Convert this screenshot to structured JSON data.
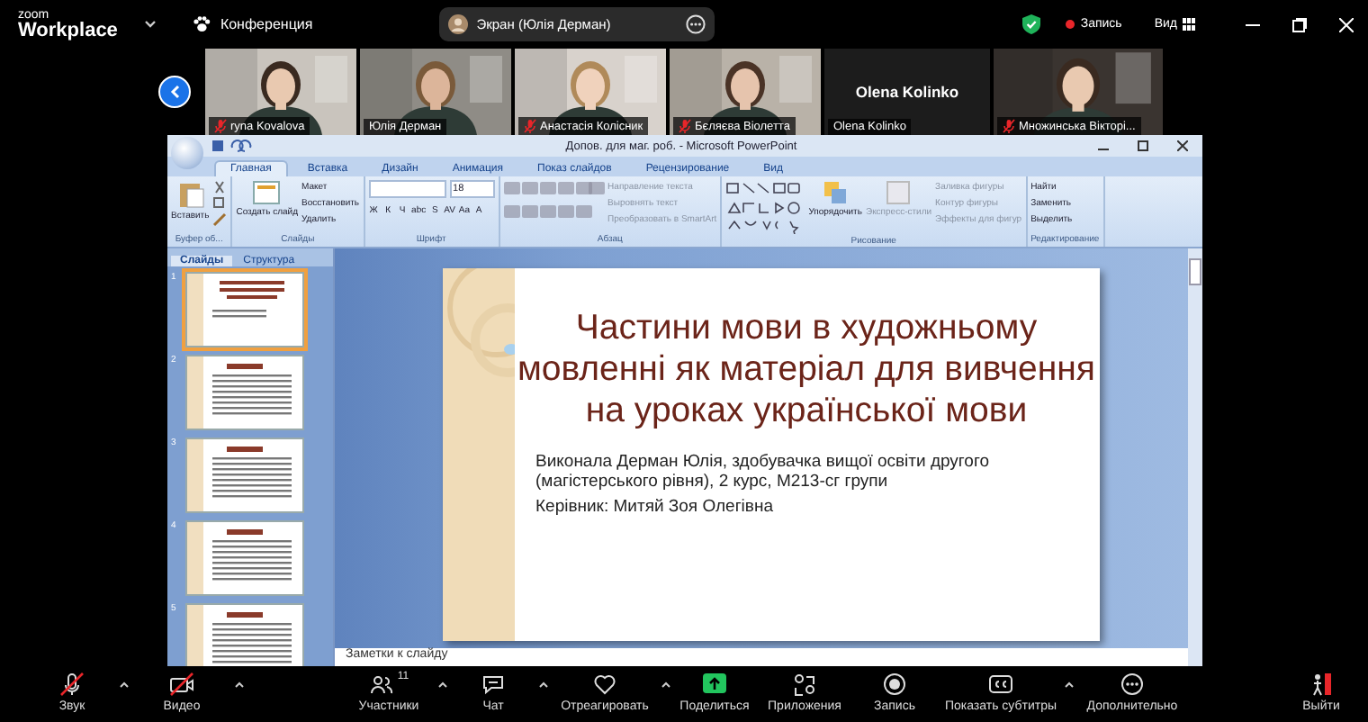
{
  "topbar": {
    "logo_small": "zoom",
    "logo": "Workplace",
    "meeting": "Конференция",
    "share_pill": "Экран (Юлія Дерман)",
    "recording": "Запись",
    "view": "Вид"
  },
  "participants": [
    {
      "kind": "video",
      "name": "ryna Kovalova",
      "muted": true
    },
    {
      "kind": "video",
      "name": "Юлія Дерман",
      "muted": false
    },
    {
      "kind": "video",
      "name": "Анастасія Колісник",
      "muted": true
    },
    {
      "kind": "video",
      "name": "Бєляєва Віолетта",
      "muted": true
    },
    {
      "kind": "name",
      "name": "Olena Kolinko",
      "muted": false,
      "display": "Olena Kolinko"
    },
    {
      "kind": "video",
      "name": "Множинська Вікторі...",
      "muted": true
    }
  ],
  "powerpoint": {
    "title": "Допов. для маг. роб. - Microsoft PowerPoint",
    "tabs": [
      {
        "label": "Главная",
        "selected": true
      },
      {
        "label": "Вставка",
        "selected": false
      },
      {
        "label": "Дизайн",
        "selected": false
      },
      {
        "label": "Анимация",
        "selected": false
      },
      {
        "label": "Показ слайдов",
        "selected": false
      },
      {
        "label": "Рецензирование",
        "selected": false
      },
      {
        "label": "Вид",
        "selected": false
      }
    ],
    "groups": [
      {
        "kind": "clipboard",
        "label": "Буфер об...",
        "big": [
          "Вставить"
        ]
      },
      {
        "kind": "slides",
        "label": "Слайды",
        "big": [
          "Создать слайд"
        ],
        "items": [
          "Макет",
          "Восстановить",
          "Удалить"
        ]
      },
      {
        "kind": "font",
        "label": "Шрифт",
        "size": "18",
        "buttons": [
          "Ж",
          "К",
          "Ч",
          "abc",
          "S",
          "AV",
          "Aa",
          "A"
        ]
      },
      {
        "kind": "paragraph",
        "label": "Абзац",
        "items": [
          "Направление текста",
          "Выровнять текст",
          "Преобразовать в SmartArt"
        ]
      },
      {
        "kind": "drawing",
        "label": "Рисование",
        "big": [
          "Упорядочить",
          "Экспресс-стили"
        ],
        "items": [
          "Заливка фигуры",
          "Контур фигуры",
          "Эффекты для фигур"
        ]
      },
      {
        "kind": "editing",
        "label": "Редактирование",
        "items": [
          "Найти",
          "Заменить",
          "Выделить"
        ]
      }
    ],
    "panel_tabs": [
      {
        "label": "Слайды",
        "selected": true
      },
      {
        "label": "Структура",
        "selected": false
      }
    ],
    "thumbnails": [
      {
        "number": "1",
        "selected": true
      },
      {
        "number": "2",
        "selected": false
      },
      {
        "number": "3",
        "selected": false
      },
      {
        "number": "4",
        "selected": false
      },
      {
        "number": "5",
        "selected": false
      }
    ],
    "slide": {
      "title": "Частини мови в художньому мовленні як матеріал для вивчення на уроках української мови",
      "body": [
        "Виконала Дерман Юлія, здобувачка вищої освіти другого (магістерського рівня), 2 курс, М213-сг групи",
        "Керівник: Митяй Зоя Олегівна"
      ]
    },
    "notes": "Заметки к слайду"
  },
  "toolbar": [
    {
      "kind": "mic",
      "label": "Звук",
      "off": true,
      "caret": true
    },
    {
      "kind": "camera",
      "label": "Видео",
      "off": true,
      "caret": true
    },
    {
      "kind": "participants",
      "label": "Участники",
      "count": "11",
      "caret": true
    },
    {
      "kind": "chat",
      "label": "Чат",
      "caret": true
    },
    {
      "kind": "react",
      "label": "Отреагировать",
      "caret": true
    },
    {
      "kind": "share",
      "label": "Поделиться",
      "caret": false
    },
    {
      "kind": "apps",
      "label": "Приложения",
      "caret": false
    },
    {
      "kind": "record",
      "label": "Запись",
      "caret": false
    },
    {
      "kind": "captions",
      "label": "Показать субтитры",
      "caret": true
    },
    {
      "kind": "more",
      "label": "Дополнительно",
      "caret": false
    },
    {
      "kind": "leave",
      "label": "Выйти",
      "caret": false
    }
  ]
}
